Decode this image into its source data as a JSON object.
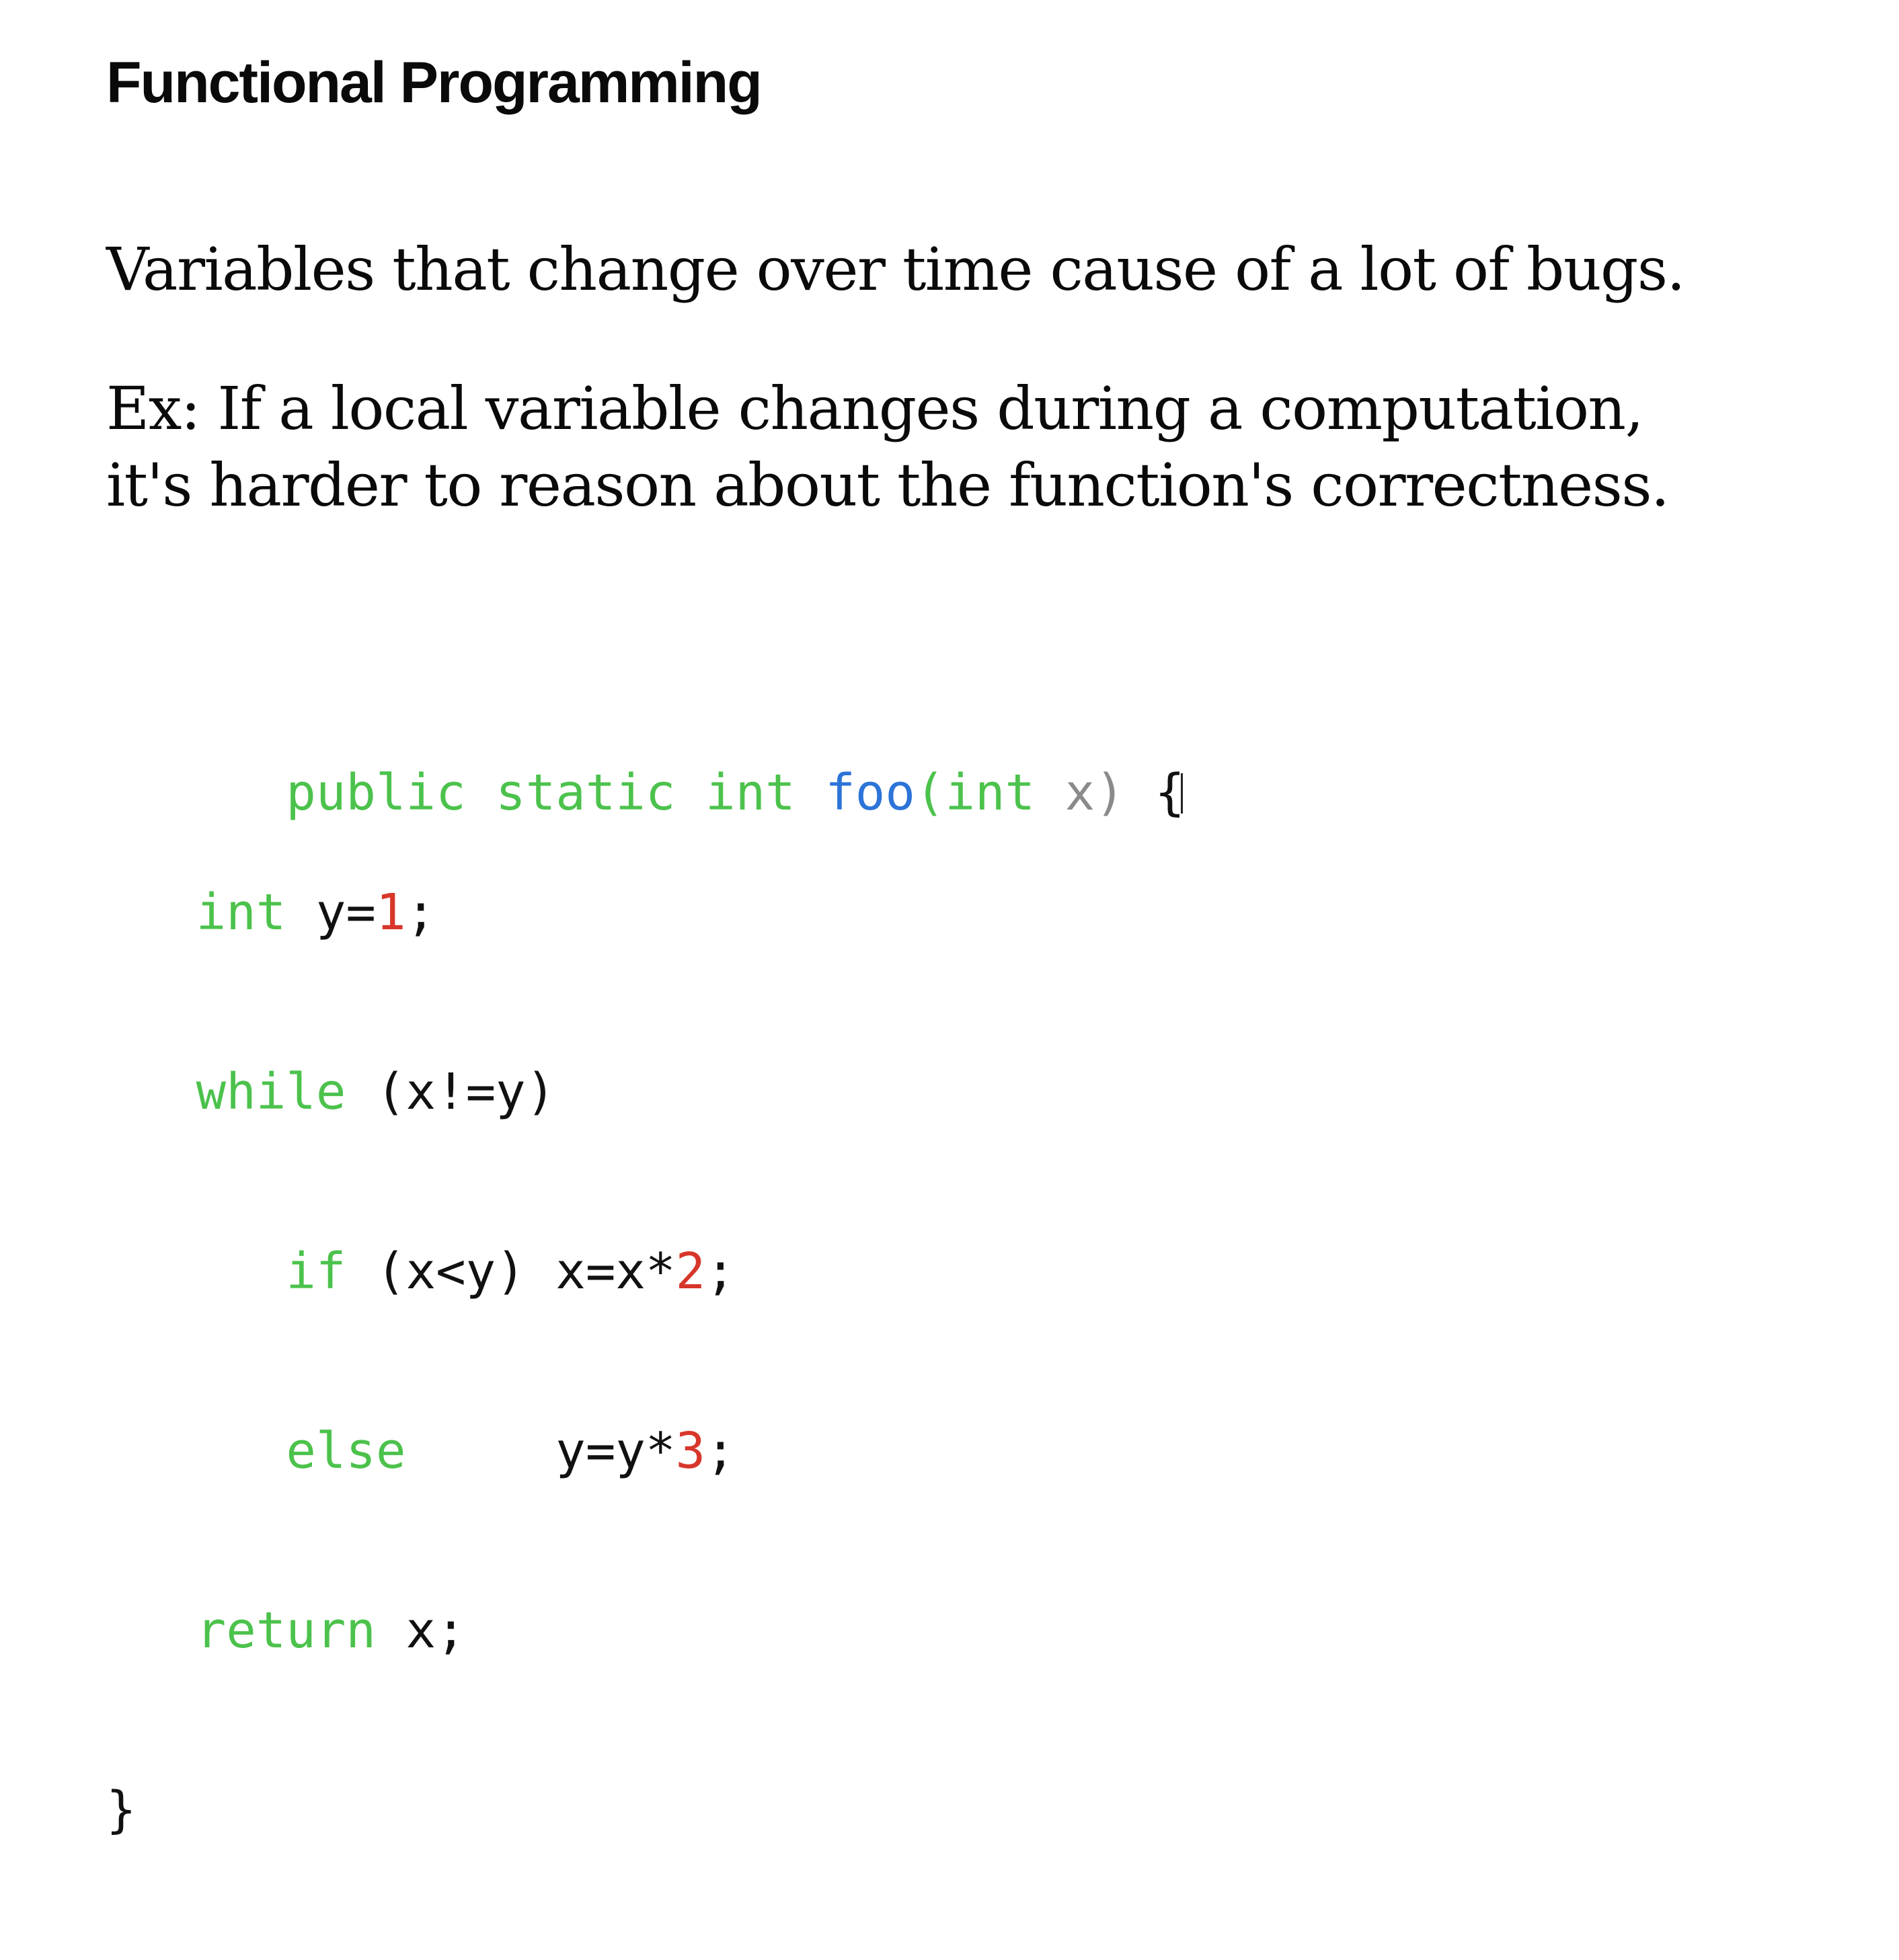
{
  "slide": {
    "title": "Functional Programming",
    "paragraphs": [
      "Variables that change over time cause of a lot of bugs.",
      "Ex: If a local variable changes during a computation,",
      "it's harder to reason about the function's correctness."
    ]
  },
  "code": {
    "lines": [
      [
        {
          "text": "public static int ",
          "kind": "keyword"
        },
        {
          "text": "foo",
          "kind": "function"
        },
        {
          "text": "(int ",
          "kind": "keyword"
        },
        {
          "text": "x) ",
          "kind": "dim"
        },
        {
          "text": "{",
          "kind": "plain"
        }
      ],
      [
        {
          "text": "   ",
          "kind": "plain"
        },
        {
          "text": "int",
          "kind": "keyword"
        },
        {
          "text": " y=",
          "kind": "plain"
        },
        {
          "text": "1",
          "kind": "number"
        },
        {
          "text": ";",
          "kind": "plain"
        }
      ],
      [
        {
          "text": "   ",
          "kind": "plain"
        },
        {
          "text": "while",
          "kind": "keyword"
        },
        {
          "text": " (x!=y)",
          "kind": "plain"
        }
      ],
      [
        {
          "text": "      ",
          "kind": "plain"
        },
        {
          "text": "if",
          "kind": "keyword"
        },
        {
          "text": " (x<y) x=x*",
          "kind": "plain"
        },
        {
          "text": "2",
          "kind": "number"
        },
        {
          "text": ";",
          "kind": "plain"
        }
      ],
      [
        {
          "text": "      ",
          "kind": "plain"
        },
        {
          "text": "else",
          "kind": "keyword"
        },
        {
          "text": "     y=y*",
          "kind": "plain"
        },
        {
          "text": "3",
          "kind": "number"
        },
        {
          "text": ";",
          "kind": "plain"
        }
      ],
      [
        {
          "text": "   ",
          "kind": "plain"
        },
        {
          "text": "return",
          "kind": "keyword"
        },
        {
          "text": " x;",
          "kind": "plain"
        }
      ],
      [
        {
          "text": "}",
          "kind": "plain"
        }
      ]
    ]
  },
  "colors": {
    "keyword": "#4cc24c",
    "function": "#2c74d8",
    "number": "#d8362a",
    "dim": "#8a8a8a",
    "plain": "#111111",
    "background": "#ffffff"
  }
}
